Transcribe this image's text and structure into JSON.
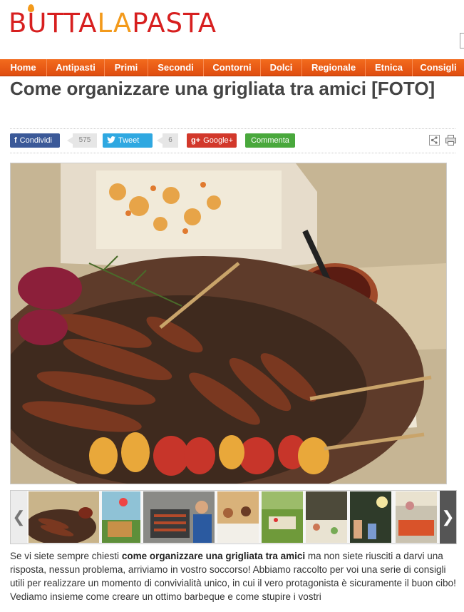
{
  "header": {
    "logo_pre": "BUTTA",
    "logo_la": "LA",
    "logo_post": "PASTA",
    "brand_red": "#d71f1f",
    "brand_orange": "#f39a1b"
  },
  "nav": {
    "color": "#ec5a16",
    "items": [
      {
        "label": "Home"
      },
      {
        "label": "Antipasti"
      },
      {
        "label": "Primi"
      },
      {
        "label": "Secondi"
      },
      {
        "label": "Contorni"
      },
      {
        "label": "Dolci"
      },
      {
        "label": "Regionale"
      },
      {
        "label": "Etnica"
      },
      {
        "label": "Consigli"
      }
    ]
  },
  "article": {
    "title": "Come organizzare una grigliata tra amici [FOTO]"
  },
  "social": {
    "facebook": {
      "icon": "f",
      "label": "Condividi",
      "count": "575",
      "color": "#3b5998"
    },
    "twitter": {
      "icon": "twitter-bird-icon",
      "label": "Tweet",
      "count": "6",
      "color": "#2fa8e1"
    },
    "googleplus": {
      "icon": "g+",
      "label": "Google+",
      "color": "#d2382b"
    },
    "comment": {
      "label": "Commenta",
      "color": "#49a83c"
    }
  },
  "gallery": {
    "hero_alt": "grigliata di salsicce e verdure",
    "thumbnails": [
      {
        "name": "thumb-sausages"
      },
      {
        "name": "thumb-picnic-basket"
      },
      {
        "name": "thumb-barbecue-man"
      },
      {
        "name": "thumb-outdoor-table"
      },
      {
        "name": "thumb-garden-picnic"
      },
      {
        "name": "thumb-party-table"
      },
      {
        "name": "thumb-evening-party"
      },
      {
        "name": "thumb-buffet"
      }
    ]
  },
  "intro": {
    "t1": "Se vi siete sempre chiesti ",
    "bold": "come organizzare una grigliata tra amici",
    "t2": " ma non siete riusciti a darvi una risposta, nessun problema, arriviamo in vostro soccorso! Abbiamo raccolto per voi una serie di consigli utili per realizzare un momento di convivialità unico, in cui il vero protagonista è sicuramente il buon cibo! Vediamo insieme come creare un ottimo barbeque e come stupire i vostri"
  }
}
